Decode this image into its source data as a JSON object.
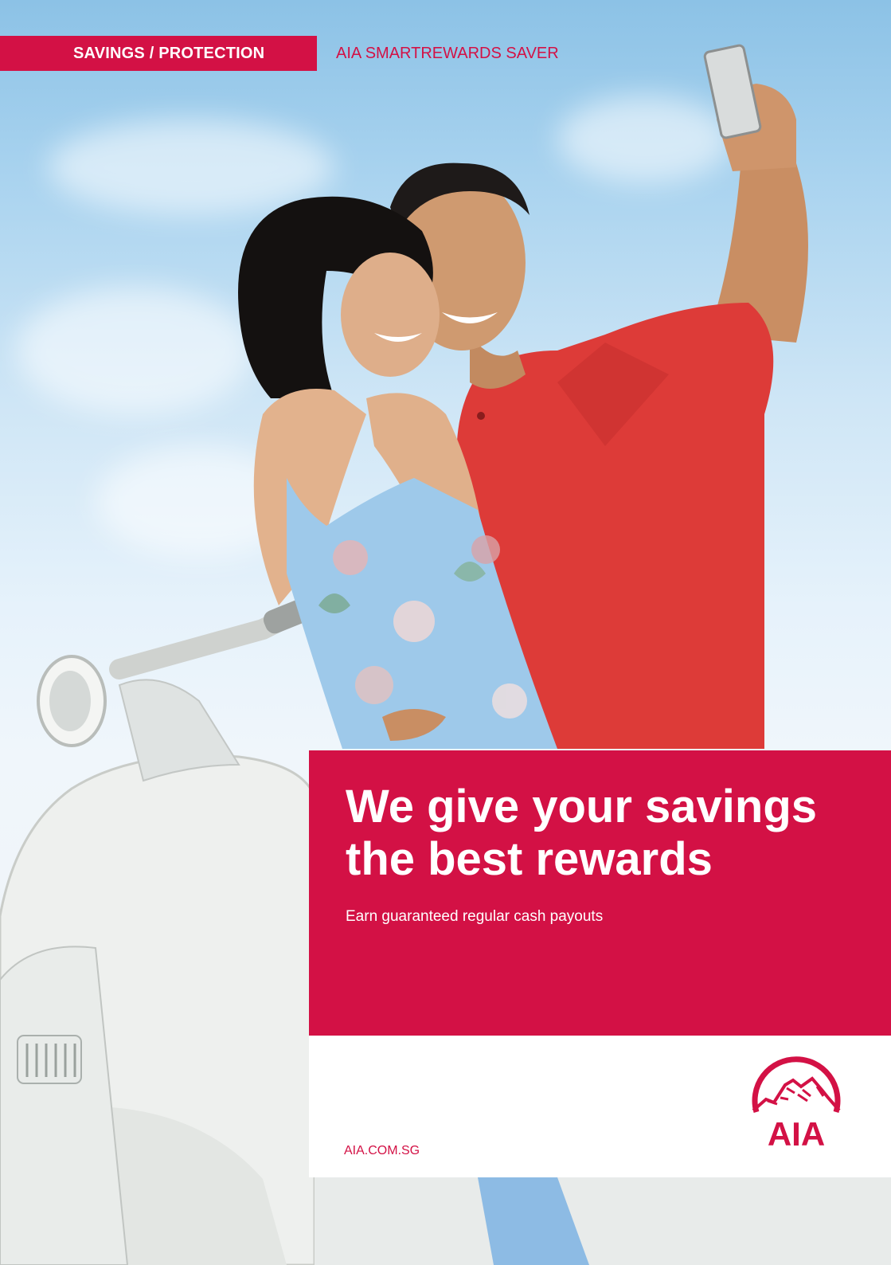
{
  "header": {
    "category_label": "SAVINGS / PROTECTION",
    "product_name": "AIA SMARTREWARDS SAVER"
  },
  "hero": {
    "headline": "We give your savings the best rewards",
    "subheadline": "Earn guaranteed regular cash payouts"
  },
  "footer": {
    "website": "AIA.COM.SG",
    "logo_text": "AIA"
  },
  "colors": {
    "brand_red": "#d31145",
    "white": "#ffffff",
    "sky": "#a9d3ef"
  },
  "icons": {
    "logo": "aia-mountain-logo-icon"
  }
}
